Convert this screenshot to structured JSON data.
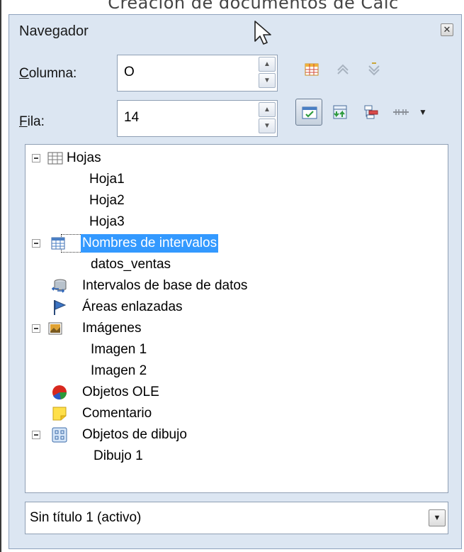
{
  "page": {
    "title": "Creación de documentos de Calc"
  },
  "navigator": {
    "title": "Navegador",
    "close_icon": "close-icon",
    "column_label_accel": "C",
    "column_label_rest": "olumna:",
    "column_value": "O",
    "row_label_accel": "F",
    "row_label_rest": "ila:",
    "row_value": "14",
    "toolbar": [
      "data-range-icon",
      "start-icon",
      "end-icon",
      "contents-toggle-icon",
      "scenarios-icon",
      "drag-mode-icon",
      "link-chain-icon"
    ],
    "tree": {
      "sheets": {
        "label": "Hojas",
        "children": [
          "Hoja1",
          "Hoja2",
          "Hoja3"
        ]
      },
      "range_names": {
        "label": "Nombres de intervalos",
        "children": [
          "datos_ventas"
        ]
      },
      "db_ranges": {
        "label": "Intervalos de base de datos"
      },
      "linked_areas": {
        "label": "Áreas enlazadas"
      },
      "images": {
        "label": "Imágenes",
        "children": [
          "Imagen 1",
          "Imagen 2"
        ]
      },
      "ole_objects": {
        "label": "Objetos OLE"
      },
      "comments": {
        "label": "Comentario"
      },
      "drawing_objects": {
        "label": "Objetos de dibujo",
        "children": [
          "Dibujo 1"
        ]
      }
    },
    "document_select": "Sin título 1 (activo)"
  },
  "colors": {
    "panel_bg": "#dce6f2",
    "selection": "#3399ff"
  }
}
